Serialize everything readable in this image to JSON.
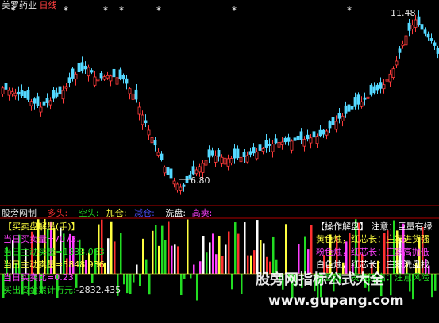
{
  "top_title": {
    "stock_name": "美罗药业",
    "period": "日线"
  },
  "price_panel": {
    "high_label": "11.48",
    "low_label": "6.80",
    "star_glyph": "*",
    "colors": {
      "up": "#ff3b3b",
      "down": "#54d8ff",
      "bg": "#000000"
    }
  },
  "indicator_bar": {
    "label": "股旁网制",
    "items": [
      {
        "text": "多头:",
        "color": "#ff3030"
      },
      {
        "text": "空头:",
        "color": "#22dd22"
      },
      {
        "text": "加仓:",
        "color": "#ffff40"
      },
      {
        "text": "减仓:",
        "color": "#5050ff"
      },
      {
        "text": "洗盘:",
        "color": "#ffffff"
      },
      {
        "text": "高卖:",
        "color": "#ff40ff"
      }
    ]
  },
  "left_panel": {
    "title": "【买卖盘解量(手)】",
    "lines": [
      {
        "text": "当日买卖量=7073.",
        "color": "#ff40ff"
      },
      {
        "text": "当日主动买量=1333.063",
        "color": "#22dd22"
      },
      {
        "text": "当日主动卖量=5848.936",
        "color": "#ffff40"
      },
      {
        "text": "当日买卖比=0.23",
        "color": "#ff40ff"
      },
      {
        "text": "买出资金累计万元:",
        "color": "#22dd22"
      }
    ],
    "extra_value": "-2832.435"
  },
  "right_panel": {
    "header": "【操作解盘】 注意：巨量有绿",
    "lines": [
      {
        "text": "黄色烛，红芯长：庄家进货强",
        "color": "#ffff40"
      },
      {
        "text": "粉色烛，红芯长：庄家高抛低",
        "color": "#ff40ff"
      },
      {
        "text": "白色烛，红芯长：庄家洗盘找",
        "color": "#ffffff"
      },
      {
        "text": "巨量绿，资金流出：注意风险",
        "color": "#22dd22"
      }
    ]
  },
  "watermark": {
    "cn": "股旁网指标公式大全",
    "url": "www.gupang.com"
  }
}
